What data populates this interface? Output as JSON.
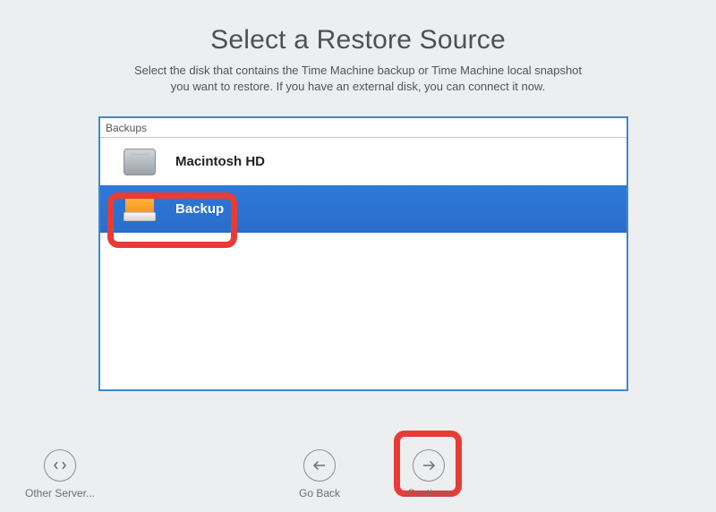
{
  "header": {
    "title": "Select a Restore Source",
    "subtitle_line1": "Select the disk that contains the Time Machine backup or Time Machine local snapshot",
    "subtitle_line2": "you want to restore. If you have an external disk, you can connect it now."
  },
  "panel": {
    "section_label": "Backups",
    "items": [
      {
        "label": "Macintosh HD",
        "icon": "internal-hdd",
        "selected": false
      },
      {
        "label": "Backup",
        "icon": "external-drive",
        "selected": true
      }
    ]
  },
  "footer": {
    "other_server_label": "Other Server...",
    "go_back_label": "Go Back",
    "continue_label": "Continue"
  }
}
